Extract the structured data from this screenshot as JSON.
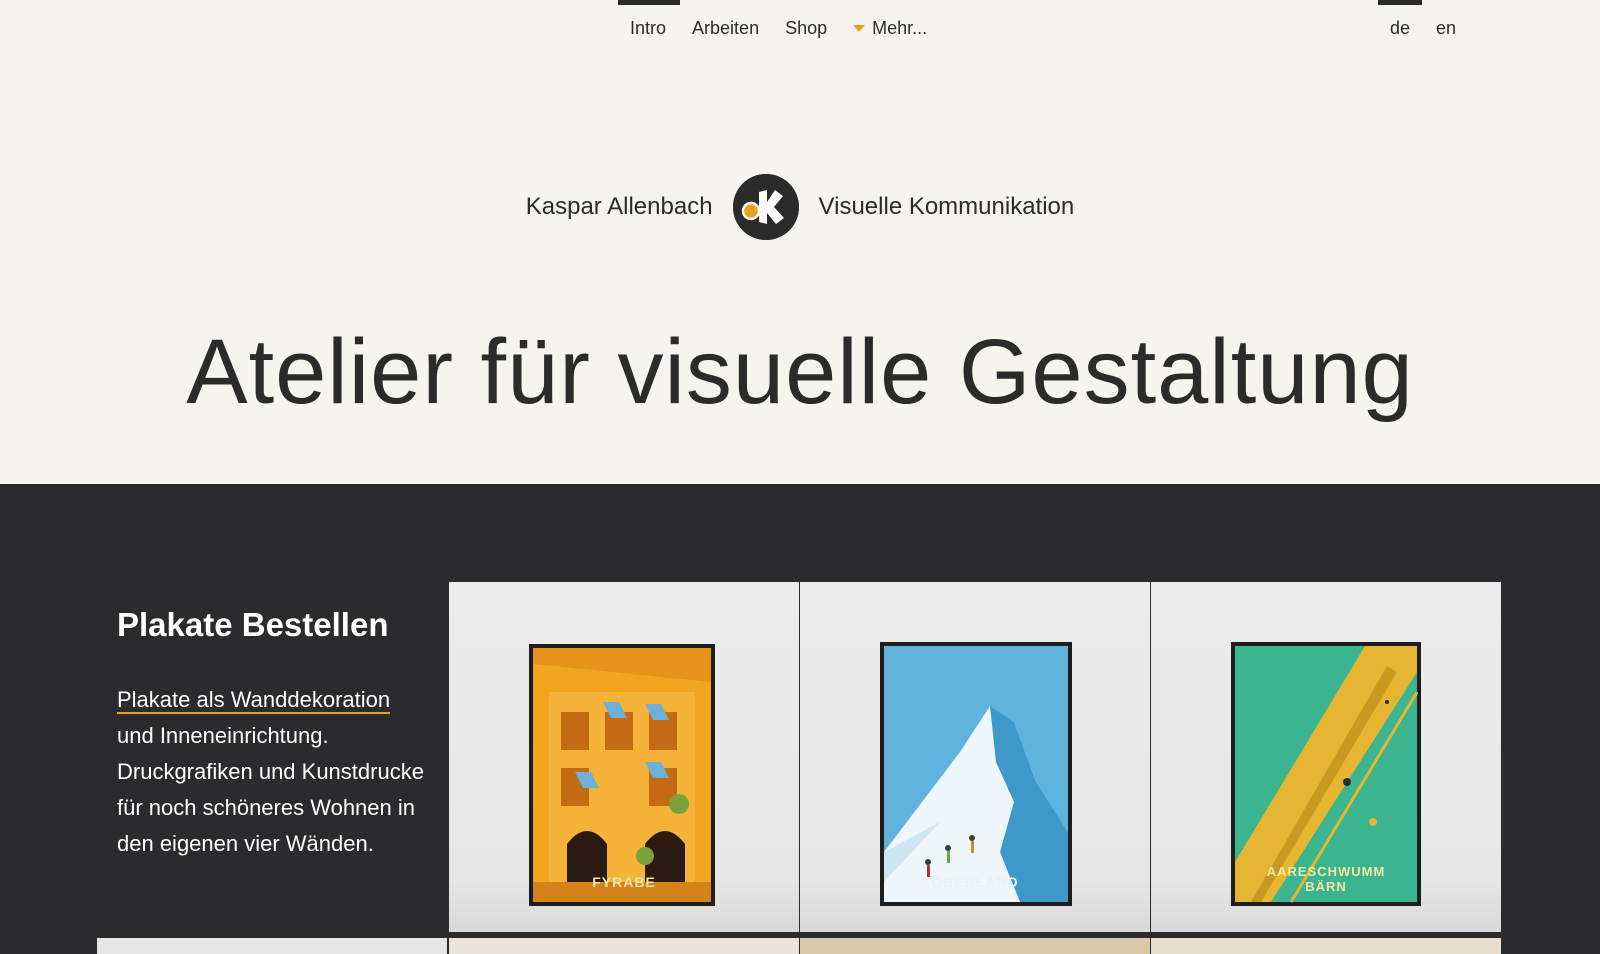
{
  "nav": {
    "items": [
      {
        "label": "Intro",
        "active": true
      },
      {
        "label": "Arbeiten",
        "active": false
      },
      {
        "label": "Shop",
        "active": false
      },
      {
        "label": "Mehr...",
        "active": false,
        "icon": "caret-down-icon"
      }
    ],
    "languages": [
      {
        "label": "de",
        "active": true
      },
      {
        "label": "en",
        "active": false
      }
    ]
  },
  "brand": {
    "name": "Kaspar Allenbach",
    "tagline": "Visuelle Kommunikation",
    "logo_icon": "k-logo-icon"
  },
  "hero": {
    "title": "Atelier für visuelle Gestaltung"
  },
  "shop_section": {
    "heading": "Plakate Bestellen",
    "link_text": "Plakate als Wanddekoration",
    "text": "und Inneneinrichtung. Druckgrafiken und Kunstdrucke für noch schöneres Wohnen in den eigenen vier Wänden.",
    "posters": [
      {
        "caption": "FYRABE"
      },
      {
        "caption": "OBERLAND"
      },
      {
        "caption": "AARESCHWUMM BÄRN"
      }
    ]
  },
  "colors": {
    "background": "#f6f4ee",
    "dark": "#2a2b2d",
    "accent": "#e8a21b",
    "text": "#2b2b2b"
  }
}
